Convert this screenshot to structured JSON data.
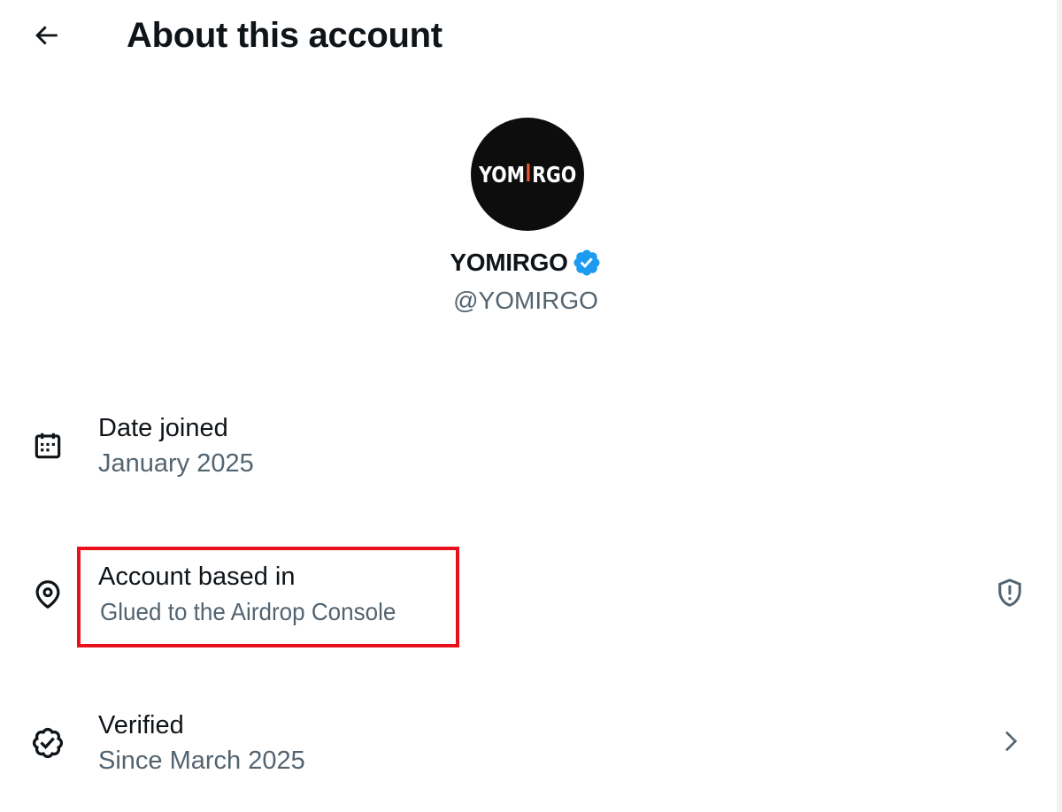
{
  "header": {
    "title": "About this account",
    "back_icon": "arrow-left-icon"
  },
  "profile": {
    "avatar_logo_left": "YOM",
    "avatar_logo_right": "RGO",
    "display_name": "YOMIRGO",
    "handle": "@YOMIRGO",
    "verified_badge_color": "#1d9bf0"
  },
  "rows": [
    {
      "icon": "calendar-icon",
      "label": "Date joined",
      "value": "January 2025"
    },
    {
      "icon": "location-pin-icon",
      "label": "Account based in",
      "value": "Glued to the Airdrop Console",
      "trailing_icon": "shield-alert-icon",
      "highlighted": true,
      "highlight_color": "#e8101a"
    },
    {
      "icon": "verified-check-icon",
      "label": "Verified",
      "value": "Since March 2025",
      "trailing_icon": "chevron-right-icon"
    }
  ],
  "colors": {
    "primary_text": "#0f1419",
    "secondary_text": "#536471",
    "background": "#ffffff"
  }
}
